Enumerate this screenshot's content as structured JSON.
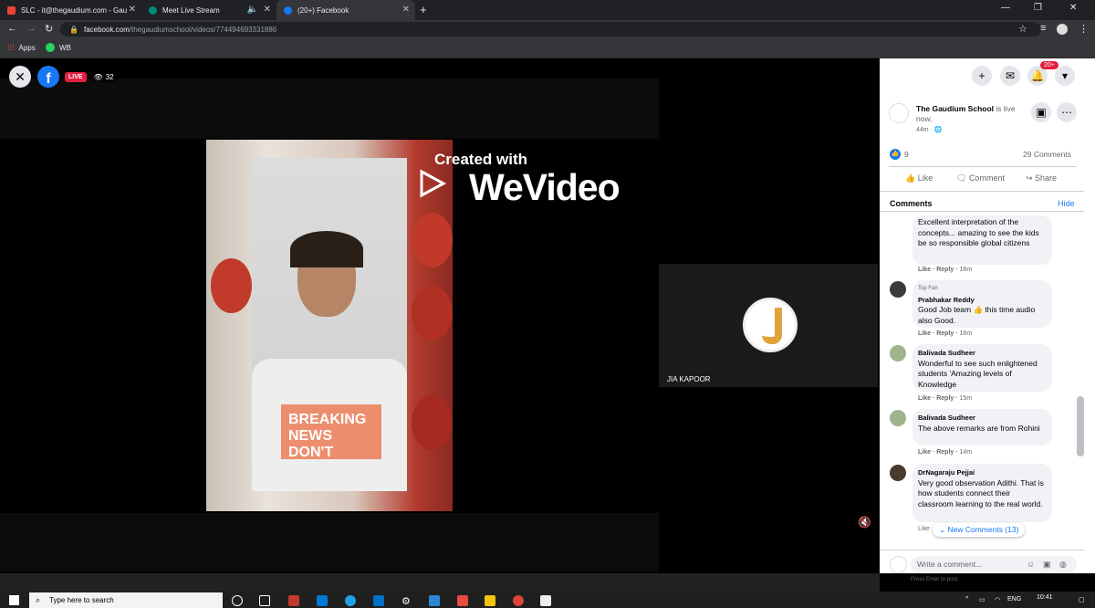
{
  "browser": {
    "tabs": [
      {
        "label": "SLC - it@thegaudium.com - Gau",
        "icon": "gmail-icon"
      },
      {
        "label": "Meet Live Stream",
        "icon": "meet-icon"
      },
      {
        "label": "(20+) Facebook",
        "icon": "facebook-icon",
        "active": true
      }
    ],
    "url_host": "facebook.com",
    "url_path": "/thegaudiumschool/videos/774494693331886",
    "bookmarks": [
      {
        "label": "Apps"
      },
      {
        "label": "WB"
      }
    ]
  },
  "video": {
    "live_label": "LIVE",
    "viewer_count": "32",
    "watermark_line1": "Created with",
    "watermark_line2": "WeVideo",
    "participant_name": "JIA KAPOOR",
    "shirt_text": "BREAKING NEWS DON'T"
  },
  "panel": {
    "notification_badge": "20+",
    "page_name": "The Gaudium School",
    "live_text": " is live now.",
    "time": "44m",
    "like_count": "9",
    "comment_count": "29 Comments",
    "actions": [
      "Like",
      "Comment",
      "Share"
    ],
    "comments_heading": "Comments",
    "hide_label": "Hide",
    "comments": [
      {
        "name": "",
        "text": "Excellent interpretation of the concepts... amazing to see the kids be so responsible global citizens",
        "meta": "16m"
      },
      {
        "name": "Prabhakar Reddy",
        "top_fan": "Top Fan",
        "text": "Good Job team 👍 this time audio also Good.",
        "meta": "16m"
      },
      {
        "name": "Balivada Sudheer",
        "text": "Wonderful to see such enlightened students 'Amazing levels of Knowledge",
        "meta": "15m"
      },
      {
        "name": "Balivada Sudheer",
        "text": "The above remarks are from Rohini",
        "meta": "14m"
      },
      {
        "name": "DrNagaraju Pejjai",
        "text": "Very good observation Adithi. That is how students connect their classroom learning to the real world.",
        "meta": "Like"
      }
    ],
    "like_reply": "Like · Reply · ",
    "new_comments": "New Comments (13)",
    "write_placeholder": "Write a comment...",
    "press_enter": "Press Enter to post."
  },
  "taskbar": {
    "search_placeholder": "Type here to search",
    "lang": "ENG",
    "time": "10:41"
  }
}
